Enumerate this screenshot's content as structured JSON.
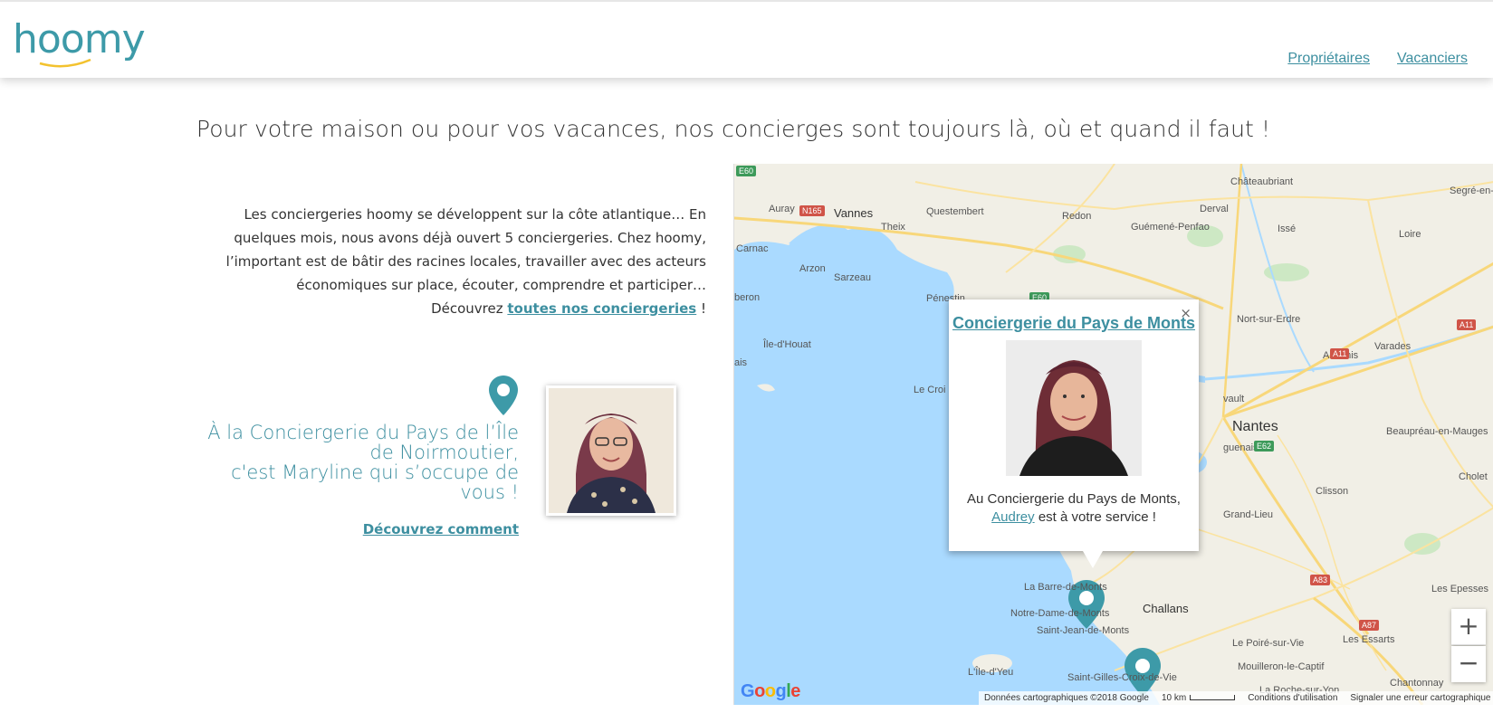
{
  "header": {
    "logo_text": "hoomy",
    "nav": [
      {
        "label": "Propriétaires"
      },
      {
        "label": "Vacanciers"
      }
    ]
  },
  "tagline": "Pour votre maison ou pour vos vacances, nos concierges sont toujours là, où et quand il faut !",
  "intro": {
    "text": "Les conciergeries hoomy se développent sur la côte atlantique… En quelques mois, nous avons déjà ouvert 5 conciergeries. Chez hoomy, l’important est de bâtir des racines locales, travailler avec des acteurs économiques sur place, écouter, comprendre et participer…",
    "discover_prefix": "Découvrez ",
    "discover_link": "toutes nos conciergeries",
    "discover_suffix": " !"
  },
  "concierge": {
    "line1": "À la Conciergerie du Pays de l’Île de Noirmoutier,",
    "line2": "c'est Maryline qui s’occupe de vous !",
    "link": "Découvrez comment"
  },
  "map": {
    "labels": [
      {
        "name": "Châteaubriant",
        "kind": "town"
      },
      {
        "name": "Segré-en-Anjou Bleu",
        "kind": "town"
      },
      {
        "name": "Auray",
        "kind": "town"
      },
      {
        "name": "Vannes",
        "kind": "town"
      },
      {
        "name": "Questembert",
        "kind": "town"
      },
      {
        "name": "Redon",
        "kind": "town"
      },
      {
        "name": "Derval",
        "kind": "town"
      },
      {
        "name": "Guémené-Penfao",
        "kind": "town"
      },
      {
        "name": "Issé",
        "kind": "town"
      },
      {
        "name": "Loire",
        "kind": "town"
      },
      {
        "name": "Theix",
        "kind": "town"
      },
      {
        "name": "Carnac",
        "kind": "town"
      },
      {
        "name": "Arzon",
        "kind": "town"
      },
      {
        "name": "Sarzeau",
        "kind": "town"
      },
      {
        "name": "Pénestin",
        "kind": "town"
      },
      {
        "name": "Nort-sur-Erdre",
        "kind": "town"
      },
      {
        "name": "Varades",
        "kind": "town"
      },
      {
        "name": "Ancenis",
        "kind": "town"
      },
      {
        "name": "Île-d'Houat",
        "kind": "town"
      },
      {
        "name": "Le Croi",
        "kind": "town"
      },
      {
        "name": "Nantes",
        "kind": "city"
      },
      {
        "name": "Beaupréau-en-Mauges",
        "kind": "town"
      },
      {
        "name": "Clisson",
        "kind": "town"
      },
      {
        "name": "Cholet",
        "kind": "town"
      },
      {
        "name": "La Barre-de-Monts",
        "kind": "town"
      },
      {
        "name": "Notre-Dame-de-Monts",
        "kind": "town"
      },
      {
        "name": "Saint-Jean-de-Monts",
        "kind": "town"
      },
      {
        "name": "Challans",
        "kind": "town"
      },
      {
        "name": "Le Poiré-sur-Vie",
        "kind": "town"
      },
      {
        "name": "Les Essarts",
        "kind": "town"
      },
      {
        "name": "Les Epesses",
        "kind": "town"
      },
      {
        "name": "Mouilleron-le-Captif",
        "kind": "town"
      },
      {
        "name": "L'Île-d'Yeu",
        "kind": "town"
      },
      {
        "name": "Saint-Gilles-Croix-de-Vie",
        "kind": "town"
      },
      {
        "name": "Chantonnay",
        "kind": "town"
      },
      {
        "name": "La Roche-sur-Yon",
        "kind": "town"
      },
      {
        "name": "Grand-Lieu",
        "kind": "town"
      },
      {
        "name": "guenais",
        "kind": "town"
      },
      {
        "name": "vault",
        "kind": "town"
      },
      {
        "name": "beron",
        "kind": "town"
      },
      {
        "name": "ais",
        "kind": "town"
      }
    ],
    "shields": [
      "E60",
      "N165",
      "A11",
      "A11",
      "E62",
      "A83",
      "A87",
      "E60"
    ],
    "zoom_in": "+",
    "zoom_out": "−",
    "google": "Google",
    "footer": {
      "data": "Données cartographiques ©2018 Google",
      "scale": "10 km",
      "terms": "Conditions d'utilisation",
      "report": "Signaler une erreur cartographique"
    }
  },
  "infowindow": {
    "title": "Conciergerie du Pays de Monts",
    "close": "×",
    "caption_prefix": "Au Conciergerie du Pays de Monts,",
    "caption_name": "Audrey",
    "caption_suffix": " est à votre service !"
  },
  "colors": {
    "accent": "#3d8fa0",
    "water": "#aadaff",
    "land": "#f1efe6"
  }
}
